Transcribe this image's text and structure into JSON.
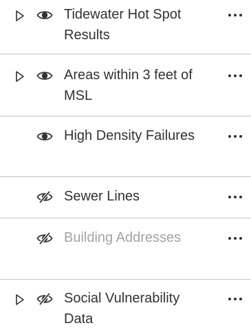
{
  "layers": [
    {
      "label": "Tidewater Hot Spot Results",
      "visible": true,
      "expandable": true,
      "dimmed": false,
      "expand_icon": "caret-right-icon",
      "eye_icon": "eye-icon",
      "more_icon": "ellipsis-icon"
    },
    {
      "label": "Areas within 3 feet of MSL",
      "visible": true,
      "expandable": true,
      "dimmed": false,
      "expand_icon": "caret-right-icon",
      "eye_icon": "eye-icon",
      "more_icon": "ellipsis-icon"
    },
    {
      "label": "High Density Failures",
      "visible": true,
      "expandable": false,
      "dimmed": false,
      "eye_icon": "eye-icon",
      "more_icon": "ellipsis-icon"
    },
    {
      "label": "Sewer Lines",
      "visible": false,
      "expandable": false,
      "dimmed": false,
      "eye_icon": "eye-off-icon",
      "more_icon": "ellipsis-icon"
    },
    {
      "label": "Building Addresses",
      "visible": false,
      "expandable": false,
      "dimmed": true,
      "eye_icon": "eye-off-icon",
      "more_icon": "ellipsis-icon"
    },
    {
      "label": "Social Vulnerability Data",
      "visible": false,
      "expandable": true,
      "dimmed": false,
      "expand_icon": "caret-right-icon",
      "eye_icon": "eye-off-icon",
      "more_icon": "ellipsis-icon"
    }
  ],
  "colors": {
    "text": "#323232",
    "text_dimmed": "#a3a3a3",
    "icon": "#323232",
    "divider": "#c4c4c4"
  }
}
